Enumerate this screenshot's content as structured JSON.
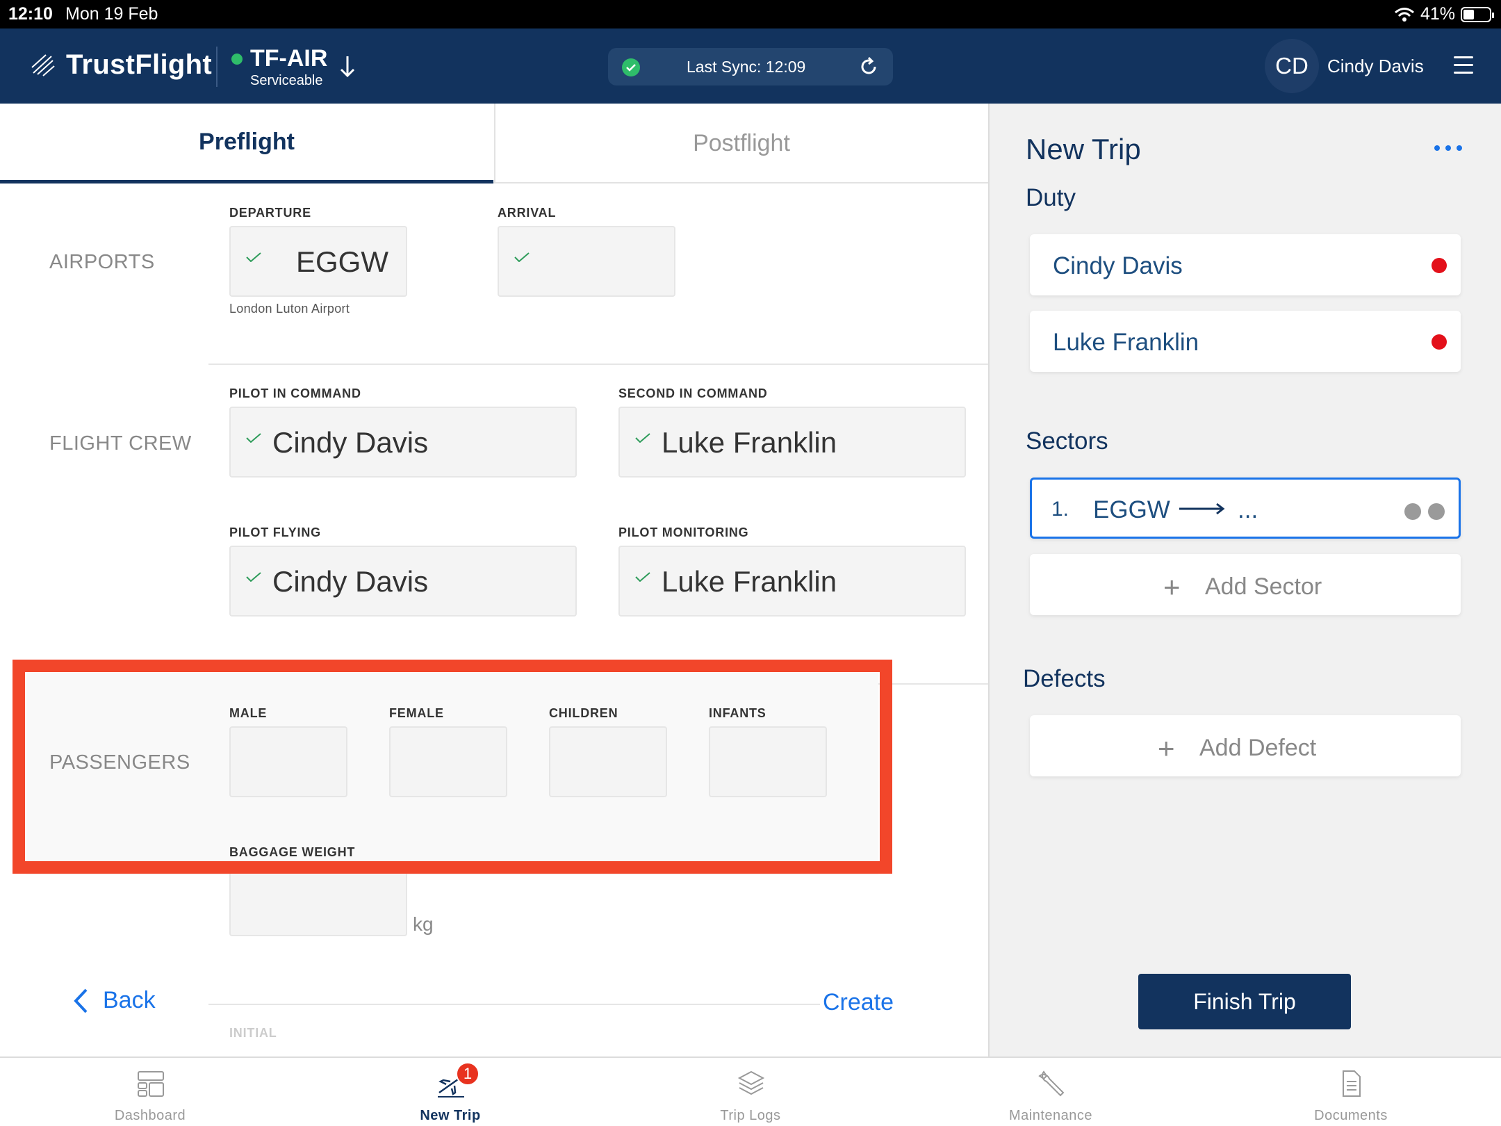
{
  "status_bar": {
    "time": "12:10",
    "date": "Mon 19 Feb",
    "battery": "41%",
    "battery_level": 0.41
  },
  "header": {
    "brand": "TrustFlight",
    "aircraft": {
      "registration": "TF-AIR",
      "status": "Serviceable"
    },
    "sync": {
      "text": "Last Sync: 12:09"
    },
    "user": {
      "initials": "CD",
      "name": "Cindy Davis"
    }
  },
  "tabs": [
    {
      "label": "Preflight"
    },
    {
      "label": "Postflight"
    }
  ],
  "airports": {
    "section": "AIRPORTS",
    "departure": {
      "label": "DEPARTURE",
      "value": "EGGW",
      "hint": "London Luton Airport"
    },
    "arrival": {
      "label": "ARRIVAL",
      "value": ""
    }
  },
  "flight_crew": {
    "section": "FLIGHT CREW",
    "pic": {
      "label": "PILOT IN COMMAND",
      "value": "Cindy Davis"
    },
    "sic": {
      "label": "SECOND IN COMMAND",
      "value": "Luke Franklin"
    },
    "pf": {
      "label": "PILOT FLYING",
      "value": "Cindy Davis"
    },
    "pm": {
      "label": "PILOT MONITORING",
      "value": "Luke Franklin"
    }
  },
  "passengers": {
    "section": "PASSENGERS",
    "male": {
      "label": "MALE",
      "value": ""
    },
    "female": {
      "label": "FEMALE",
      "value": ""
    },
    "children": {
      "label": "CHILDREN",
      "value": ""
    },
    "infants": {
      "label": "INFANTS",
      "value": ""
    },
    "baggage": {
      "label": "BAGGAGE WEIGHT",
      "value": "",
      "unit": "kg"
    }
  },
  "actions": {
    "back": "Back",
    "create": "Create"
  },
  "faded_label": "INITIAL",
  "right_panel": {
    "title": "New Trip",
    "duty_heading": "Duty",
    "duty": [
      {
        "name": "Cindy Davis"
      },
      {
        "name": "Luke Franklin"
      }
    ],
    "sectors_heading": "Sectors",
    "sectors": [
      {
        "number": "1.",
        "from": "EGGW",
        "to": "..."
      }
    ],
    "add_sector": "Add Sector",
    "defects_heading": "Defects",
    "add_defect": "Add Defect",
    "finish": "Finish Trip"
  },
  "bottom_nav": [
    {
      "label": "Dashboard",
      "icon": "dashboard-icon"
    },
    {
      "label": "New Trip",
      "icon": "plane-icon",
      "badge": "1"
    },
    {
      "label": "Trip Logs",
      "icon": "layers-icon"
    },
    {
      "label": "Maintenance",
      "icon": "wrench-icon"
    },
    {
      "label": "Documents",
      "icon": "document-icon"
    }
  ],
  "colors": {
    "brand": "#12335e",
    "accent": "#1a73e8",
    "success": "#2fbd6a",
    "alert": "#e3101a",
    "highlight": "#f2462a"
  }
}
